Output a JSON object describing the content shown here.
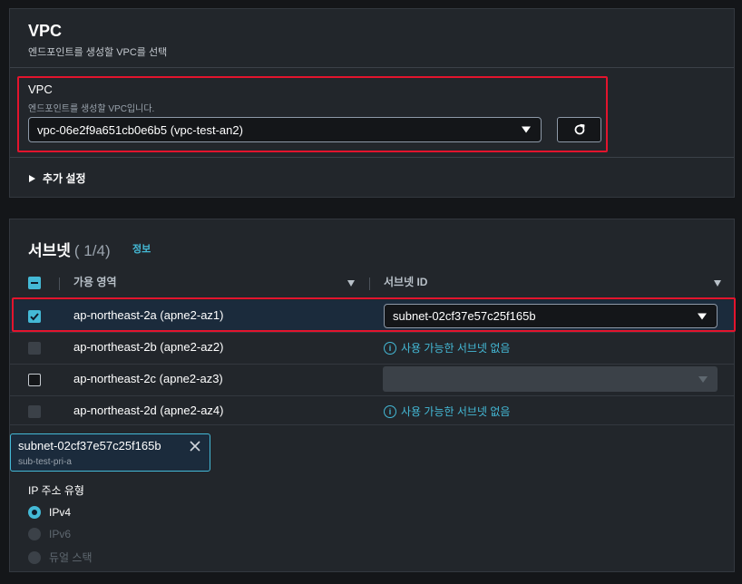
{
  "vpc_section": {
    "title": "VPC",
    "subtitle": "엔드포인트를 생성할 VPC를 선택",
    "field_label": "VPC",
    "field_description": "엔드포인트를 생성할 VPC입니다.",
    "selected_vpc": "vpc-06e2f9a651cb0e6b5 (vpc-test-an2)",
    "advanced_settings_label": "추가 설정"
  },
  "subnet_section": {
    "title": "서브넷",
    "count": "( 1/4)",
    "info_link": "정보",
    "columns": [
      "가용 영역",
      "서브넷 ID"
    ],
    "rows": [
      {
        "az": "ap-northeast-2a (apne2-az1)",
        "subnet": "subnet-02cf37e57c25f165b",
        "checkbox": "checked",
        "subnet_state": "select"
      },
      {
        "az": "ap-northeast-2b (apne2-az2)",
        "subnet": "사용 가능한 서브넷 없음",
        "checkbox": "disabled",
        "subnet_state": "none"
      },
      {
        "az": "ap-northeast-2c (apne2-az3)",
        "subnet": "",
        "checkbox": "unchecked",
        "subnet_state": "disabled-select"
      },
      {
        "az": "ap-northeast-2d (apne2-az4)",
        "subnet": "사용 가능한 서브넷 없음",
        "checkbox": "disabled",
        "subnet_state": "none"
      }
    ],
    "token": {
      "name": "subnet-02cf37e57c25f165b",
      "sub": "sub-test-pri-a"
    },
    "ip_type_label": "IP 주소 유형",
    "ip_options": [
      {
        "label": "IPv4",
        "state": "selected"
      },
      {
        "label": "IPv6",
        "state": "disabled"
      },
      {
        "label": "듀얼 스택",
        "state": "disabled"
      }
    ]
  },
  "colors": {
    "accent": "#44b9d6",
    "highlight": "#e3142d",
    "panel": "#22262b"
  }
}
